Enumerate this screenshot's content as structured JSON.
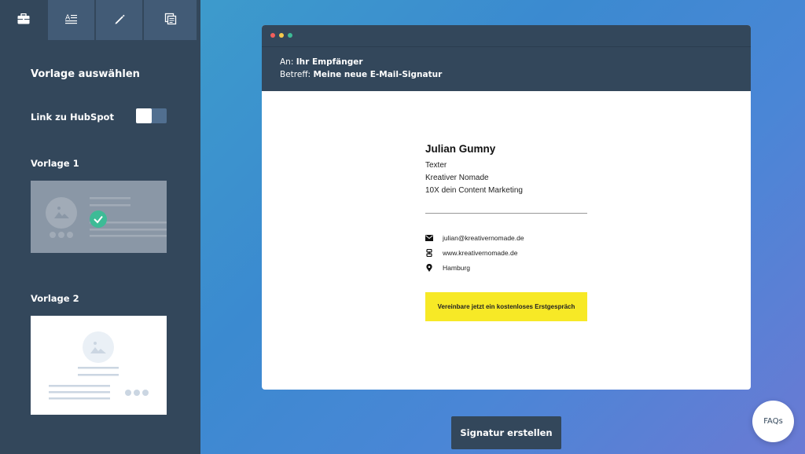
{
  "sidebar": {
    "tabs": [
      {
        "icon": "briefcase-icon"
      },
      {
        "icon": "text-format-icon"
      },
      {
        "icon": "pen-icon"
      },
      {
        "icon": "copy-icon"
      }
    ],
    "title": "Vorlage auswählen",
    "hubspot_label": "Link zu HubSpot",
    "template1_label": "Vorlage 1",
    "template2_label": "Vorlage 2"
  },
  "email": {
    "to_prefix": "An:",
    "to_value": "Ihr Empfänger",
    "subject_prefix": "Betreff:",
    "subject_value": "Meine neue E-Mail-Signatur"
  },
  "signature": {
    "name": "Julian Gumny",
    "title": "Texter",
    "company": "Kreativer Nomade",
    "tagline": "10X dein Content Marketing",
    "email": "julian@kreativernomade.de",
    "website": "www.kreativernomade.de",
    "location": "Hamburg",
    "cta": "Vereinbare jetzt ein kostenloses Erstgespräch"
  },
  "actions": {
    "create": "Signatur erstellen",
    "faq": "FAQs"
  },
  "colors": {
    "sidebar": "#33475b",
    "tab": "#425b76",
    "cta": "#f7e926",
    "check": "#3dbb96"
  }
}
